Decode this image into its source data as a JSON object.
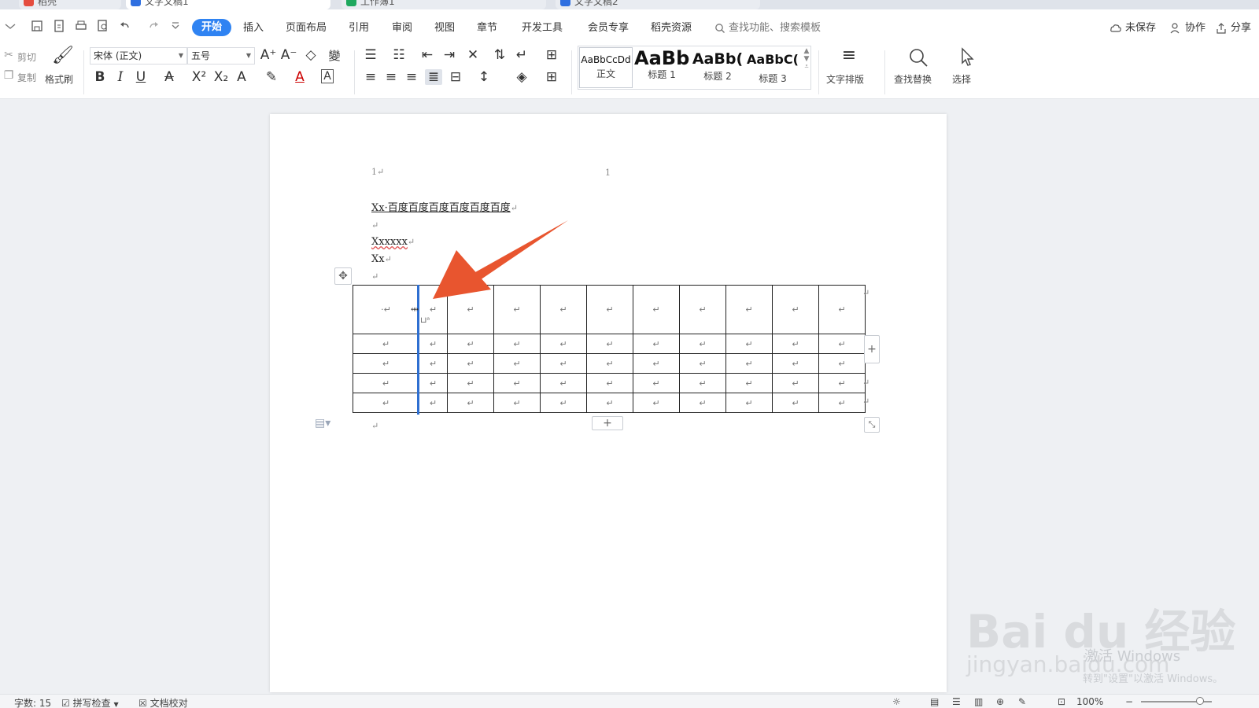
{
  "tabs": [
    {
      "label": "稻壳",
      "color": "#e54d3f"
    },
    {
      "label": "文字文稿1",
      "color": "#2f6fe0"
    },
    {
      "label": "工作簿1",
      "color": "#1fa85e"
    },
    {
      "label": "文字文稿2",
      "color": "#2f6fe0"
    }
  ],
  "menu": {
    "items": [
      "开始",
      "插入",
      "页面布局",
      "引用",
      "审阅",
      "视图",
      "章节",
      "开发工具",
      "会员专享",
      "稻壳资源"
    ],
    "active": "开始",
    "search_placeholder": "查找功能、搜索模板",
    "right": {
      "unsaved": "未保存",
      "collab": "协作",
      "share": "分享"
    }
  },
  "ribbon": {
    "cut": "剪切",
    "copy": "复制",
    "format_painter": "格式刷",
    "font_name": "宋体 (正文)",
    "font_size": "五号",
    "styles": [
      {
        "preview": "AaBbCcDd",
        "label": "正文"
      },
      {
        "preview": "AaBb",
        "label": "标题 1"
      },
      {
        "preview": "AaBb(",
        "label": "标题 2"
      },
      {
        "preview": "AaBbC(",
        "label": "标题 3"
      }
    ],
    "text_layout": "文字排版",
    "find_replace": "查找替换",
    "select": "选择"
  },
  "document": {
    "header_left": "1↵",
    "header_center": "1",
    "title": "Xx·百度百度百度百度百度百度",
    "line_blank": "↵",
    "line2": "Xxxxxx",
    "line3": "Xx",
    "para_mark": "↵",
    "cell_mark": "↵",
    "first_cell": "·↵"
  },
  "table": {
    "rows": 5,
    "cols": 11
  },
  "statusbar": {
    "word_count": "字数: 15",
    "spell_check": "拼写检查",
    "doc_proof": "文档校对",
    "zoom": "100%"
  },
  "watermark": {
    "brand": "Bai du 经验",
    "url": "jingyan.baidu.com",
    "activate": "激活 Windows",
    "activate_sub": "转到\"设置\"以激活 Windows。"
  },
  "colors": {
    "accent": "#2f83f2",
    "arrow": "#e8552f",
    "resize_bar": "#2e6fd1"
  }
}
